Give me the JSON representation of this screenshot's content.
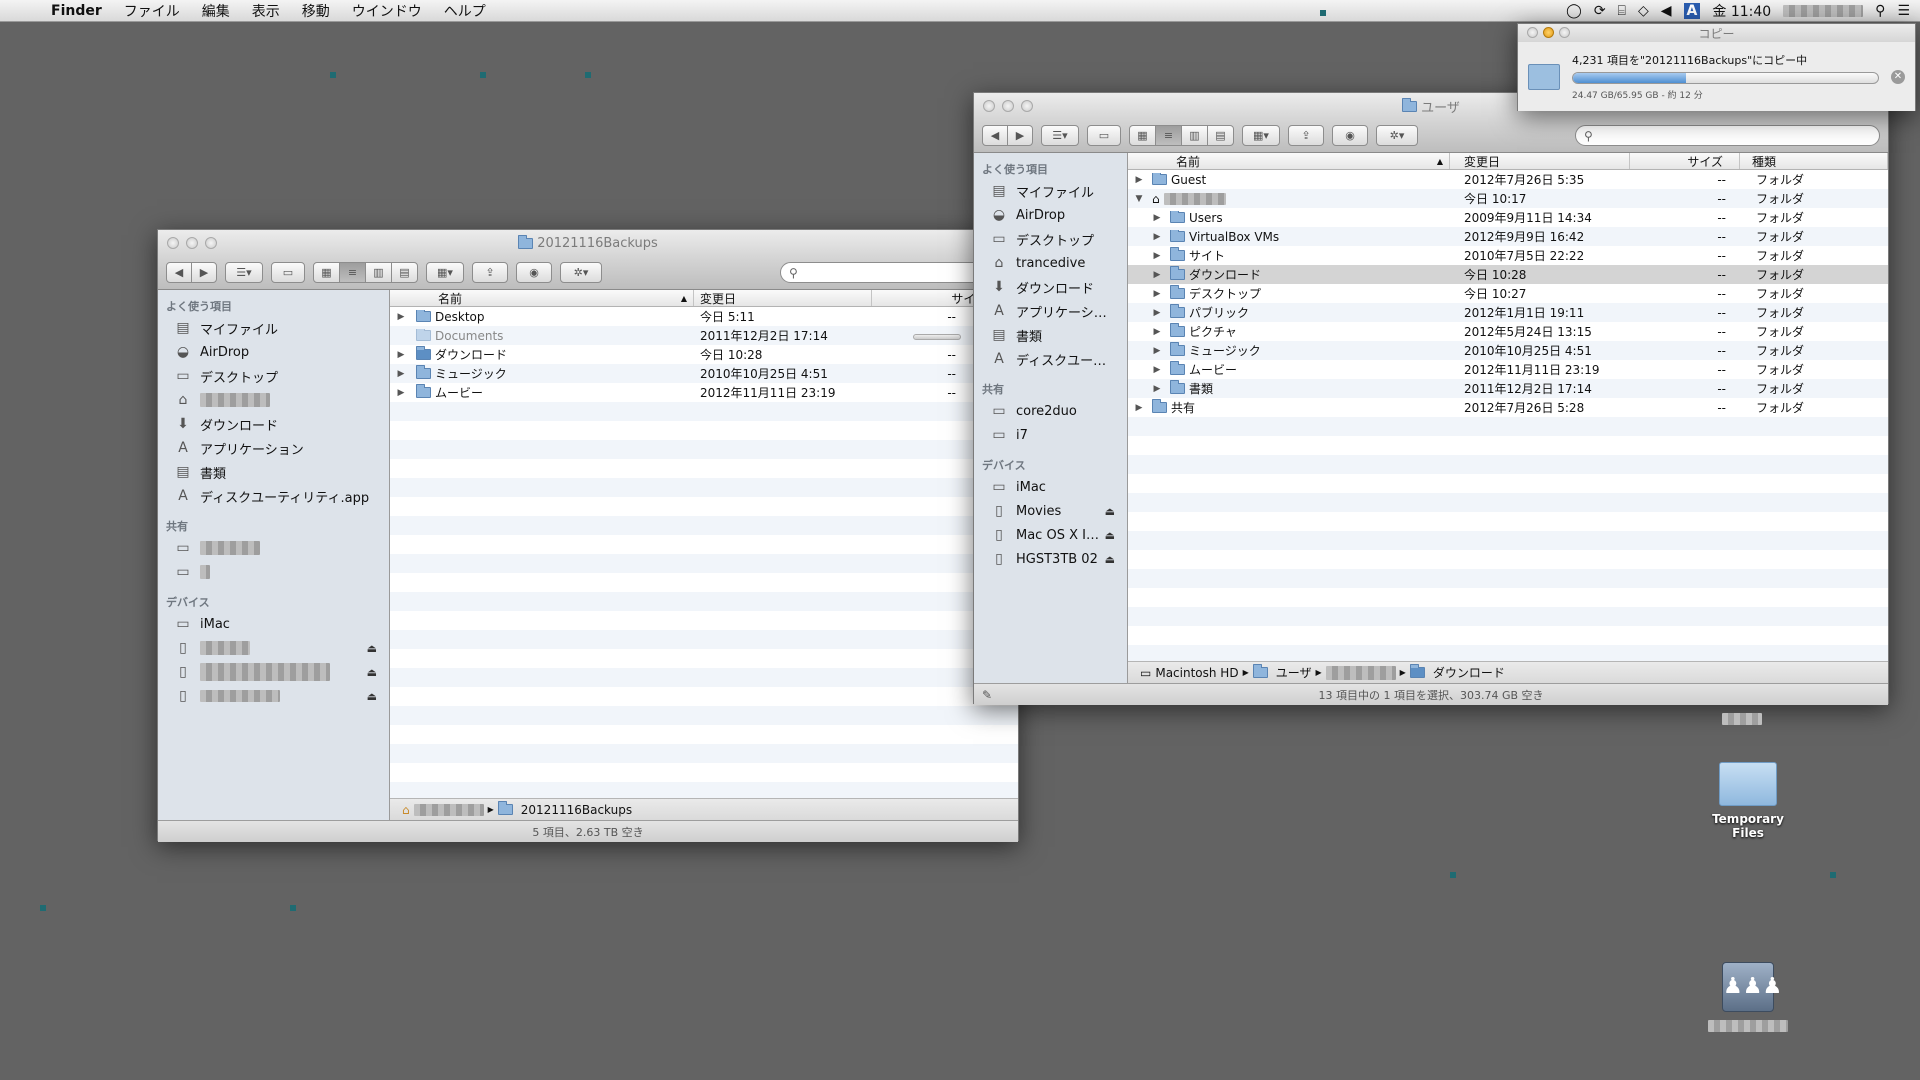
{
  "menubar": {
    "app": "Finder",
    "items": [
      "ファイル",
      "編集",
      "表示",
      "移動",
      "ウインドウ",
      "ヘルプ"
    ],
    "day": "金",
    "time": "11:40",
    "input": "A"
  },
  "copy": {
    "title": "コピー",
    "line1": "4,231 項目を\"20121116Backups\"にコピー中",
    "line2": "24.47 GB/65.95 GB - 約 12 分",
    "progress": 0.371
  },
  "left": {
    "title": "20121116Backups",
    "sidebar_favorites_head": "よく使う項目",
    "favorites": [
      {
        "label": "マイファイル",
        "icon": "all-files-icon"
      },
      {
        "label": "AirDrop",
        "icon": "airdrop-icon"
      },
      {
        "label": "デスクトップ",
        "icon": "desktop-icon"
      },
      {
        "label": "",
        "icon": "home-icon"
      },
      {
        "label": "ダウンロード",
        "icon": "download-icon"
      },
      {
        "label": "アプリケーション",
        "icon": "applications-icon"
      },
      {
        "label": "書類",
        "icon": "documents-icon"
      },
      {
        "label": "ディスクユーティリティ.app",
        "icon": "disk-utility-icon"
      }
    ],
    "shared_head": "共有",
    "devices_head": "デバイス",
    "device_imac": "iMac",
    "columns": {
      "name": "名前",
      "date": "変更日",
      "size": "サイズ"
    },
    "rows": [
      {
        "name": "Desktop",
        "date": "今日 5:11",
        "size": "--",
        "tri": true,
        "dim": false
      },
      {
        "name": "Documents",
        "date": "2011年12月2日 17:14",
        "size": "",
        "tri": false,
        "dim": true
      },
      {
        "name": "ダウンロード",
        "date": "今日 10:28",
        "size": "--",
        "tri": true,
        "dim": false
      },
      {
        "name": "ミュージック",
        "date": "2010年10月25日 4:51",
        "size": "--",
        "tri": true,
        "dim": false
      },
      {
        "name": "ムービー",
        "date": "2012年11月11日 23:19",
        "size": "--",
        "tri": true,
        "dim": false
      }
    ],
    "path_last": "20121116Backups",
    "status": "5 項目、2.63 TB 空き"
  },
  "right": {
    "title": "ユーザ",
    "sidebar_favorites_head": "よく使う項目",
    "favorites": [
      {
        "label": "マイファイル",
        "icon": "all-files-icon"
      },
      {
        "label": "AirDrop",
        "icon": "airdrop-icon"
      },
      {
        "label": "デスクトップ",
        "icon": "desktop-icon"
      },
      {
        "label": "trancedive",
        "icon": "home-icon"
      },
      {
        "label": "ダウンロード",
        "icon": "download-icon"
      },
      {
        "label": "アプリケーシ…",
        "icon": "applications-icon"
      },
      {
        "label": "書類",
        "icon": "documents-icon"
      },
      {
        "label": "ディスクユー…",
        "icon": "disk-utility-icon"
      }
    ],
    "shared_head": "共有",
    "shared": [
      "core2duo",
      "i7"
    ],
    "devices_head": "デバイス",
    "devices": [
      {
        "label": "iMac",
        "eject": false
      },
      {
        "label": "Movies",
        "eject": true
      },
      {
        "label": "Mac OS X I…",
        "eject": true
      },
      {
        "label": "HGST3TB 02",
        "eject": true
      }
    ],
    "columns": {
      "name": "名前",
      "date": "変更日",
      "size": "サイズ",
      "kind": "種類"
    },
    "rows": [
      {
        "name": "Guest",
        "date": "2012年7月26日 5:35",
        "size": "--",
        "kind": "フォルダ",
        "indent": 0,
        "tri": "▶",
        "sel": false,
        "blur": false
      },
      {
        "name": "",
        "date": "今日 10:17",
        "size": "--",
        "kind": "フォルダ",
        "indent": 0,
        "tri": "▼",
        "sel": false,
        "blur": true
      },
      {
        "name": "Users",
        "date": "2009年9月11日 14:34",
        "size": "--",
        "kind": "フォルダ",
        "indent": 1,
        "tri": "▶",
        "sel": false,
        "blur": false
      },
      {
        "name": "VirtualBox VMs",
        "date": "2012年9月9日 16:42",
        "size": "--",
        "kind": "フォルダ",
        "indent": 1,
        "tri": "▶",
        "sel": false,
        "blur": false
      },
      {
        "name": "サイト",
        "date": "2010年7月5日 22:22",
        "size": "--",
        "kind": "フォルダ",
        "indent": 1,
        "tri": "▶",
        "sel": false,
        "blur": false
      },
      {
        "name": "ダウンロード",
        "date": "今日 10:28",
        "size": "--",
        "kind": "フォルダ",
        "indent": 1,
        "tri": "▶",
        "sel": true,
        "blur": false
      },
      {
        "name": "デスクトップ",
        "date": "今日 10:27",
        "size": "--",
        "kind": "フォルダ",
        "indent": 1,
        "tri": "▶",
        "sel": false,
        "blur": false
      },
      {
        "name": "パブリック",
        "date": "2012年1月1日 19:11",
        "size": "--",
        "kind": "フォルダ",
        "indent": 1,
        "tri": "▶",
        "sel": false,
        "blur": false
      },
      {
        "name": "ピクチャ",
        "date": "2012年5月24日 13:15",
        "size": "--",
        "kind": "フォルダ",
        "indent": 1,
        "tri": "▶",
        "sel": false,
        "blur": false
      },
      {
        "name": "ミュージック",
        "date": "2010年10月25日 4:51",
        "size": "--",
        "kind": "フォルダ",
        "indent": 1,
        "tri": "▶",
        "sel": false,
        "blur": false
      },
      {
        "name": "ムービー",
        "date": "2012年11月11日 23:19",
        "size": "--",
        "kind": "フォルダ",
        "indent": 1,
        "tri": "▶",
        "sel": false,
        "blur": false
      },
      {
        "name": "書類",
        "date": "2011年12月2日 17:14",
        "size": "--",
        "kind": "フォルダ",
        "indent": 1,
        "tri": "▶",
        "sel": false,
        "blur": false
      },
      {
        "name": "共有",
        "date": "2012年7月26日 5:28",
        "size": "--",
        "kind": "フォルダ",
        "indent": 0,
        "tri": "▶",
        "sel": false,
        "blur": false
      }
    ],
    "path": {
      "p1": "Macintosh HD",
      "p2": "ユーザ",
      "p4": "ダウンロード"
    },
    "status": "13 項目中の 1 項目を選択、303.74 GB 空き"
  },
  "desktop": {
    "temp_label": "Temporary Files"
  }
}
